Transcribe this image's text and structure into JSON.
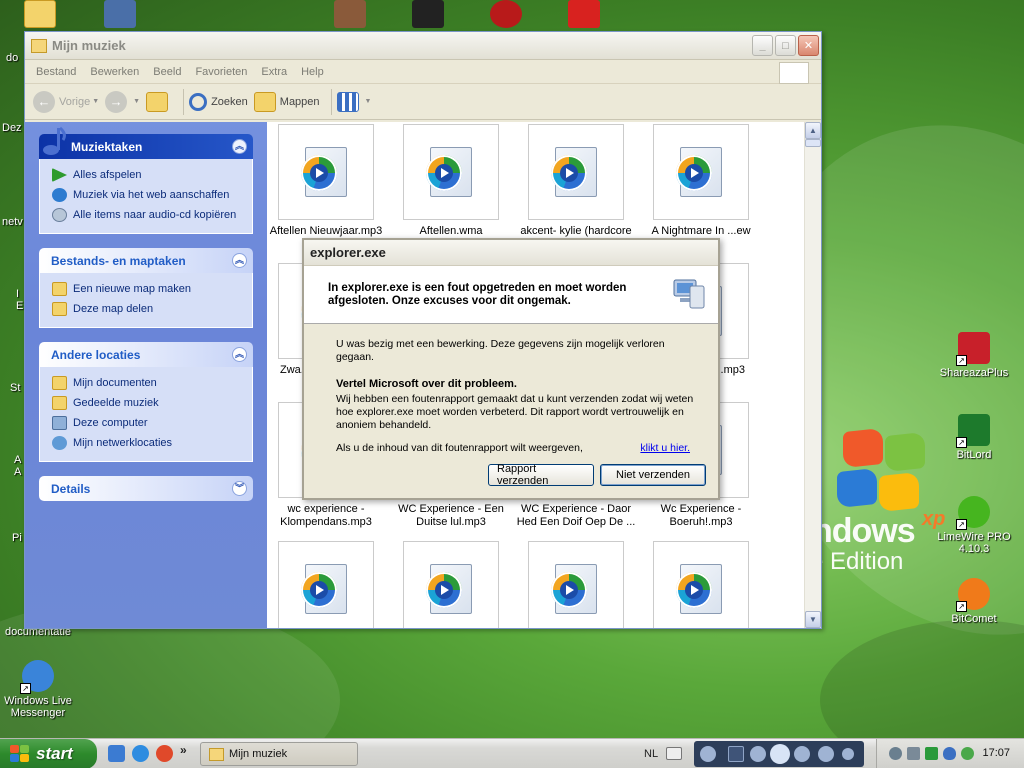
{
  "desktop": {
    "icons": [
      {
        "label": "ShareazaPlus",
        "color": "#c8202a"
      },
      {
        "label": "BitLord",
        "color": "#1d7a2c"
      },
      {
        "label": "LimeWire PRO 4.10.3",
        "color": "#46b51f"
      },
      {
        "label": "BitComet",
        "color": "#f07a1a"
      },
      {
        "label": "Windows Live Messenger",
        "color": "#3a84d9"
      },
      {
        "label": "documentatie",
        "color": "#5a7a4a"
      }
    ],
    "left_fragments": [
      "do",
      "Dez",
      "netv",
      "I E",
      "St",
      "A A",
      "Pi"
    ],
    "brand": {
      "main": "ndows",
      "xp": "xp",
      "edition": "e Edition"
    }
  },
  "explorer": {
    "title": "Mijn muziek",
    "menu": [
      "Bestand",
      "Bewerken",
      "Beeld",
      "Favorieten",
      "Extra",
      "Help"
    ],
    "toolbar": {
      "back": "Vorige",
      "search": "Zoeken",
      "folders": "Mappen"
    },
    "panels": {
      "music": {
        "title": "Muziektaken",
        "items": [
          "Alles afspelen",
          "Muziek via het web aanschaffen",
          "Alle items naar audio-cd kopiëren"
        ]
      },
      "files": {
        "title": "Bestands- en maptaken",
        "items": [
          "Een nieuwe map maken",
          "Deze map delen"
        ]
      },
      "places": {
        "title": "Andere locaties",
        "items": [
          "Mijn documenten",
          "Gedeelde muziek",
          "Deze computer",
          "Mijn netwerklocaties"
        ]
      },
      "details": {
        "title": "Details"
      }
    },
    "files": [
      {
        "name": "Aftellen Nieuwjaar.mp3"
      },
      {
        "name": "Aftellen.wma"
      },
      {
        "name": "akcent- kylie (hardcore"
      },
      {
        "name": "A Nightmare In ...ew Ha..."
      },
      {
        "name": "Zwa... Japie"
      },
      {
        "name": "...e- Mag ik ...mp3"
      },
      {
        "name": "wc experience - Klompendans.mp3"
      },
      {
        "name": "WC Experience - Een Duitse lul.mp3"
      },
      {
        "name": "WC Experience - Daor Hed Een Doif Oep De ..."
      },
      {
        "name": "Wc Experience - Boeruh!.mp3"
      },
      {
        "name": ""
      },
      {
        "name": ""
      },
      {
        "name": ""
      },
      {
        "name": ""
      }
    ]
  },
  "dialog": {
    "title": "explorer.exe",
    "header": "In explorer.exe is een fout opgetreden en moet worden afgesloten. Onze excuses voor dit ongemak.",
    "info": "U was bezig met een bewerking. Deze gegevens zijn mogelijk verloren gegaan.",
    "heading": "Vertel Microsoft over dit probleem.",
    "body": "Wij hebben een foutenrapport gemaakt dat u kunt verzenden zodat wij weten hoe explorer.exe moet worden verbeterd. Dit rapport wordt vertrouwelijk en anoniem behandeld.",
    "view_text": "Als u de inhoud van dit foutenrapport wilt weergeven,",
    "view_link": "klikt u hier.",
    "send_button": "Rapport verzenden",
    "dont_send_button": "Niet verzenden"
  },
  "taskbar": {
    "start": "start",
    "task_button": "Mijn muziek",
    "language": "NL",
    "clock": "17:07",
    "more": "»"
  }
}
